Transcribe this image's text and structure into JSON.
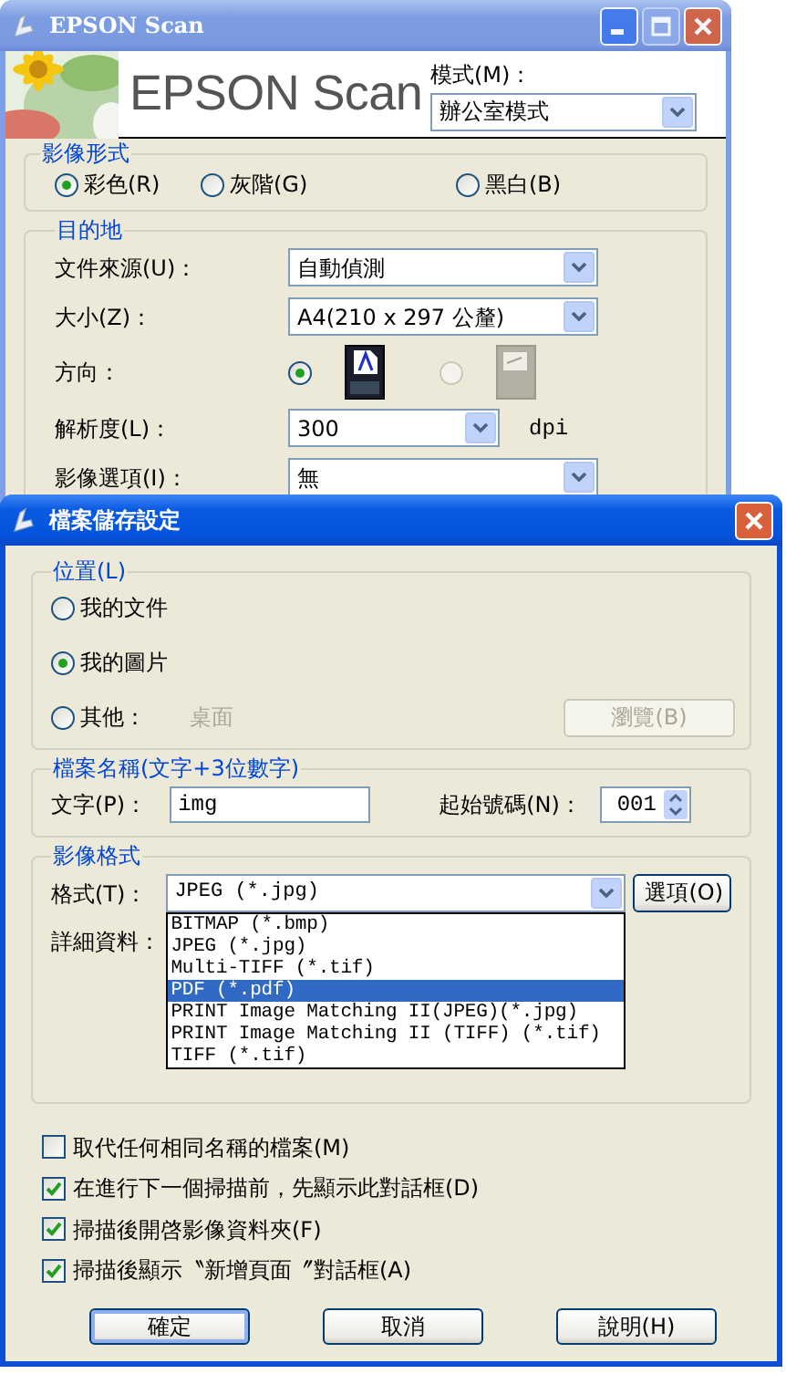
{
  "main_window": {
    "title": "EPSON Scan",
    "title_buttons": [
      {
        "kind": "minimize",
        "disabled": false
      },
      {
        "kind": "maximize",
        "disabled": true
      },
      {
        "kind": "close",
        "disabled": false
      }
    ],
    "banner": {
      "logo": "EPSON Scan",
      "mode_label": "模式(M)：",
      "mode_value": "辦公室模式"
    },
    "image_type": {
      "title": "影像形式",
      "options": [
        {
          "label": "彩色(R)",
          "selected": true
        },
        {
          "label": "灰階(G)",
          "selected": false
        },
        {
          "label": "黑白(B)",
          "selected": false
        }
      ]
    },
    "destination": {
      "title": "目的地",
      "rows": [
        {
          "kind": "select",
          "label": "文件來源(U)：",
          "value": "自動偵測"
        },
        {
          "kind": "select",
          "label": "大小(Z)：",
          "value": "A4(210 x 297 公釐)"
        },
        {
          "kind": "orientation",
          "label": "方向：",
          "options": [
            {
              "kind": "portrait",
              "selected": true,
              "disabled": false
            },
            {
              "kind": "landscape",
              "selected": false,
              "disabled": true
            }
          ]
        },
        {
          "kind": "select",
          "label": "解析度(L)：",
          "value": "300",
          "unit": "dpi"
        },
        {
          "kind": "select",
          "label": "影像選項(I)：",
          "value": "無"
        }
      ]
    }
  },
  "dialog": {
    "title": "檔案儲存設定",
    "location": {
      "title": "位置(L)",
      "options": [
        {
          "label": "我的文件",
          "selected": false
        },
        {
          "label": "我的圖片",
          "selected": true
        },
        {
          "label": "其他：",
          "selected": false,
          "path": "桌面"
        }
      ],
      "browse": {
        "label": "瀏覽(B)",
        "disabled": true
      }
    },
    "file_name": {
      "title": "檔案名稱(文字+3位數字)",
      "prefix_label": "文字(P)：",
      "prefix": "img",
      "start_label": "起始號碼(N)：",
      "start": "001"
    },
    "image_format": {
      "title": "影像格式",
      "format_label": "格式(T)：",
      "format_value": "JPEG (*.jpg)",
      "expanded": true,
      "options_button": "選項(O)",
      "details_label": "詳細資料：",
      "list": [
        {
          "label": "BITMAP (*.bmp)",
          "selected": false
        },
        {
          "label": "JPEG (*.jpg)",
          "selected": false
        },
        {
          "label": "Multi-TIFF (*.tif)",
          "selected": false
        },
        {
          "label": "PDF (*.pdf)",
          "selected": true
        },
        {
          "label": "PRINT Image Matching II(JPEG)(*.jpg)",
          "selected": false
        },
        {
          "label": "PRINT Image Matching II (TIFF) (*.tif)",
          "selected": false
        },
        {
          "label": "TIFF (*.tif)",
          "selected": false
        }
      ]
    },
    "checkboxes": [
      {
        "label": "取代任何相同名稱的檔案(M)",
        "checked": false
      },
      {
        "label": "在進行下一個掃描前，先顯示此對話框(D)",
        "checked": true
      },
      {
        "label": "掃描後開啓影像資料夾(F)",
        "checked": true
      },
      {
        "label": "掃描後顯示〝新增頁面〞對話框(A)",
        "checked": true
      }
    ],
    "buttons": [
      {
        "label": "確定",
        "default": true
      },
      {
        "label": "取消",
        "default": false
      },
      {
        "label": "說明(H)",
        "default": false
      }
    ]
  }
}
